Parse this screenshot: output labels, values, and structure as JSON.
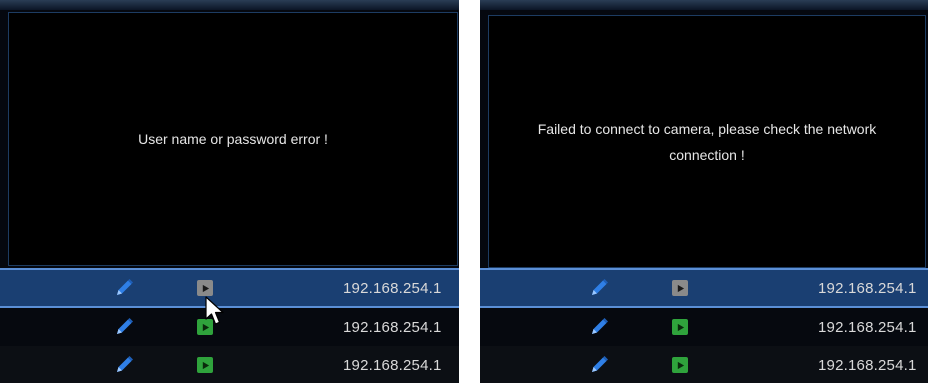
{
  "left_panel": {
    "dialog_message": "User name or password error !",
    "rows": [
      {
        "ip": "192.168.254.1",
        "state": "inactive",
        "selected": true
      },
      {
        "ip": "192.168.254.1",
        "state": "active",
        "selected": false
      },
      {
        "ip": "192.168.254.1",
        "state": "active",
        "selected": false
      }
    ]
  },
  "right_panel": {
    "dialog_message": "Failed to connect to camera, please check the network connection !",
    "rows": [
      {
        "ip": "192.168.254.1",
        "state": "inactive",
        "selected": true
      },
      {
        "ip": "192.168.254.1",
        "state": "active",
        "selected": false
      },
      {
        "ip": "192.168.254.1",
        "state": "active",
        "selected": false
      }
    ]
  },
  "icons": {
    "edit": "pencil-icon",
    "play_active": "play-green-icon",
    "play_inactive": "play-gray-icon"
  },
  "colors": {
    "selection": "#1a3f72",
    "selection_border": "#5b8fd6",
    "edit_blue": "#2f7fe6",
    "play_green": "#2fa33c",
    "play_gray": "#8a8a8a"
  }
}
